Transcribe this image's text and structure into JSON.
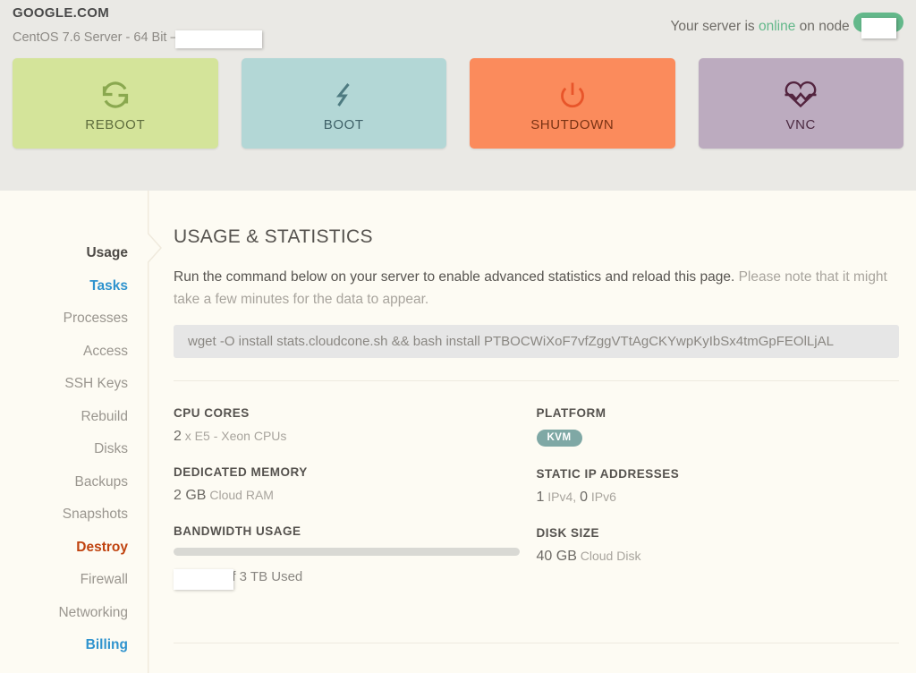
{
  "header": {
    "domain": "GOOGLE.COM",
    "os_line": "CentOS 7.6 Server - 64 Bit —",
    "os_redacted": "",
    "status_prefix": "Your server is ",
    "status_state": "online",
    "status_mid": " on node ",
    "node_value": "",
    "colors": {
      "online": "#63b88a",
      "band": "#eae9e5"
    }
  },
  "actions": [
    {
      "label": "REBOOT",
      "icon": "reboot-icon",
      "color": "#d4e49a"
    },
    {
      "label": "BOOT",
      "icon": "bolt-icon",
      "color": "#b3d7d6"
    },
    {
      "label": "SHUTDOWN",
      "icon": "power-icon",
      "color": "#fb8b5c"
    },
    {
      "label": "VNC",
      "icon": "heartbeat-icon",
      "color": "#bcabbf"
    }
  ],
  "sidebar": {
    "items": [
      {
        "label": "Usage",
        "state": "active"
      },
      {
        "label": "Tasks",
        "state": "link"
      },
      {
        "label": "Processes",
        "state": "muted"
      },
      {
        "label": "Access",
        "state": "muted"
      },
      {
        "label": "SSH Keys",
        "state": "muted"
      },
      {
        "label": "Rebuild",
        "state": "muted"
      },
      {
        "label": "Disks",
        "state": "muted"
      },
      {
        "label": "Backups",
        "state": "muted"
      },
      {
        "label": "Snapshots",
        "state": "muted"
      },
      {
        "label": "Destroy",
        "state": "danger"
      },
      {
        "label": "Firewall",
        "state": "muted"
      },
      {
        "label": "Networking",
        "state": "muted"
      },
      {
        "label": "Billing",
        "state": "link"
      }
    ]
  },
  "main": {
    "title": "USAGE & STATISTICS",
    "lede_strong": "Run the command below on your server to enable advanced statistics and reload this page.",
    "lede_faded": " Please note that it might take a few minutes for the data to appear.",
    "command": "wget -O install stats.cloudcone.sh && bash install PTBOCWiXoF7vfZggVTtAgCKYwpKyIbSx4tmGpFEOlLjAL",
    "stats": {
      "cpu_cores": {
        "label": "CPU CORES",
        "value": "2",
        "unit": " x E5 - Xeon CPUs"
      },
      "platform": {
        "label": "PLATFORM",
        "badge": "KVM",
        "badge_color": "#7fa8a5"
      },
      "memory": {
        "label": "DEDICATED MEMORY",
        "value": "2 GB",
        "unit": " Cloud RAM"
      },
      "static_ip": {
        "label": "STATIC IP ADDRESSES",
        "v4_count": "1",
        "v4_unit": " IPv4, ",
        "v6_count": "0",
        "v6_unit": " IPv6"
      },
      "bandwidth": {
        "label": "BANDWIDTH USAGE",
        "used_redacted": "",
        "suffix": "of 3 TB Used",
        "total": "3 TB",
        "percent": 0
      },
      "disk": {
        "label": "DISK SIZE",
        "value": "40 GB",
        "unit": " Cloud Disk"
      }
    }
  }
}
